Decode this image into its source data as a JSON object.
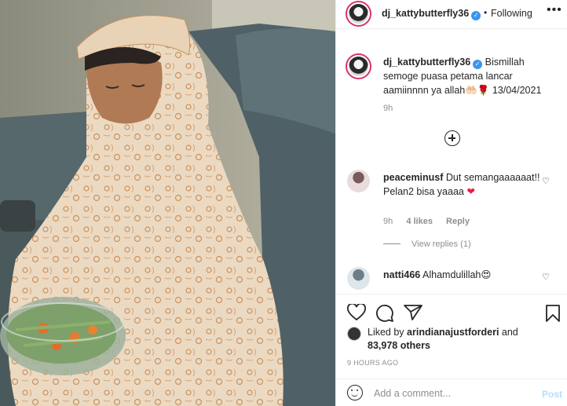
{
  "post": {
    "username": "dj_kattybutterfly36",
    "follow_separator": "•",
    "follow_status": "Following",
    "more_icon": "more-dots-icon",
    "verified_icon": "verified-badge-icon",
    "photo_alt": "photo-post"
  },
  "caption": {
    "username": "dj_kattybutterfly36",
    "text": " Bismillah semoge puasa petama lancar aamiinnnn ya allah🤲🏻🌹 13/04/2021",
    "time": "9h"
  },
  "comments": [
    {
      "username": "peaceminusf",
      "text": " Dut semangaaaaaat!! Pelan2 bisa yaaaa",
      "emoji": "❤",
      "time": "9h",
      "likes": "4 likes",
      "reply": "Reply"
    },
    {
      "username": "natti466",
      "text": " Alhamdulillah",
      "emoji": "😍"
    }
  ],
  "view_replies": "View replies (1)",
  "likes": {
    "prefix": "Liked by ",
    "user": "arindianajustforderi",
    "middle": " and",
    "others": "83,978 others"
  },
  "timeago": "9 HOURS AGO",
  "add_comment": {
    "placeholder": "Add a comment...",
    "post_label": "Post"
  },
  "colors": {
    "link": "#3897f0",
    "post_disabled": "#b2dffc",
    "story_ring": "#d8336a",
    "muted": "#8e8e8e"
  }
}
